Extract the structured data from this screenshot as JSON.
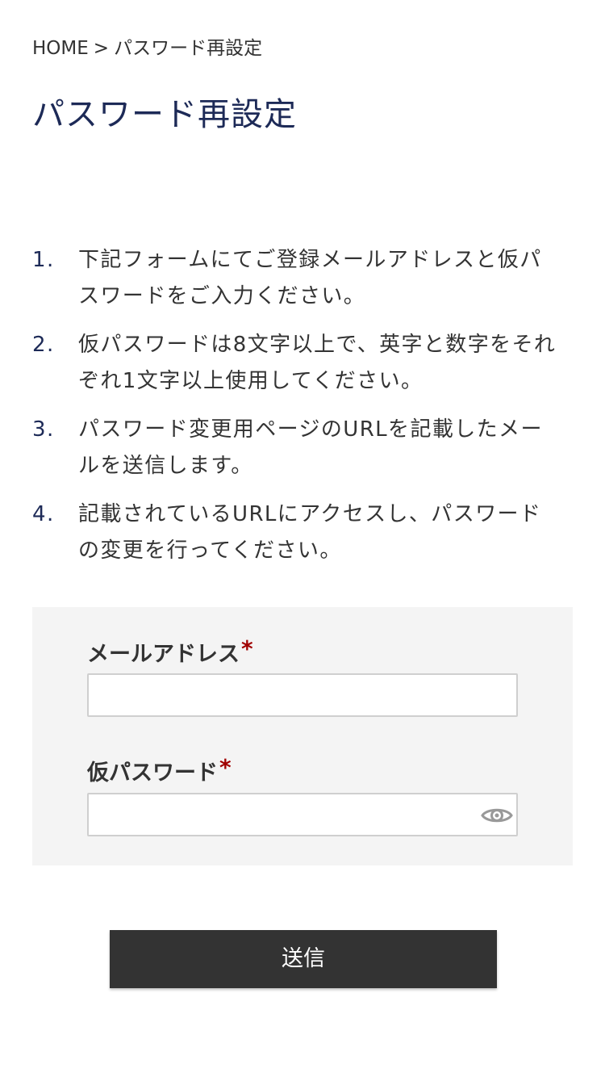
{
  "breadcrumb": {
    "home": "HOME",
    "separator": ">",
    "current": "パスワード再設定"
  },
  "page": {
    "title": "パスワード再設定"
  },
  "steps": [
    {
      "num": "1.",
      "text": "下記フォームにてご登録メールアドレスと仮パスワードをご入力ください。"
    },
    {
      "num": "2.",
      "text": "仮パスワードは8文字以上で、英字と数字をそれぞれ1文字以上使用してください。"
    },
    {
      "num": "3.",
      "text": "パスワード変更用ページのURLを記載したメールを送信します。"
    },
    {
      "num": "4.",
      "text": "記載されているURLにアクセスし、パスワードの変更を行ってください。"
    }
  ],
  "form": {
    "email": {
      "label": "メールアドレス",
      "required_mark": "*",
      "value": "",
      "placeholder": ""
    },
    "password": {
      "label": "仮パスワード",
      "required_mark": "*",
      "value": "",
      "placeholder": "",
      "toggle_icon": "eye-icon"
    },
    "submit_label": "送信"
  },
  "colors": {
    "title": "#1d2a57",
    "required": "#a00000",
    "panel_bg": "#f4f4f4",
    "button_bg": "#333333"
  }
}
